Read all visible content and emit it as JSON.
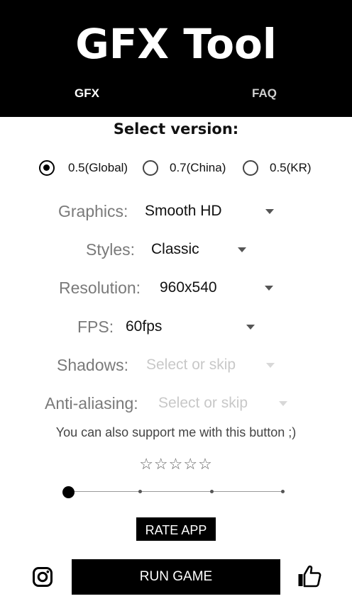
{
  "header": {
    "title": "GFX Tool",
    "tabs": [
      {
        "label": "GFX",
        "active": true
      },
      {
        "label": "FAQ",
        "active": false
      }
    ]
  },
  "version": {
    "title": "Select version:",
    "options": [
      {
        "label": "0.5(Global)",
        "selected": true
      },
      {
        "label": "0.7(China)",
        "selected": false
      },
      {
        "label": "0.5(KR)",
        "selected": false
      }
    ]
  },
  "settings": {
    "graphics": {
      "label": "Graphics:",
      "value": "Smooth HD"
    },
    "styles": {
      "label": "Styles:",
      "value": "Classic"
    },
    "resolution": {
      "label": "Resolution:",
      "value": "960x540"
    },
    "fps": {
      "label": "FPS:",
      "value": "60fps"
    },
    "shadows": {
      "label": "Shadows:",
      "placeholder": "Select or skip"
    },
    "anti_aliasing": {
      "label": "Anti-aliasing:",
      "placeholder": "Select or skip"
    }
  },
  "support": {
    "text": "You can also support me with this button ;)",
    "stars": "☆☆☆☆☆",
    "rating": 0,
    "slider_position": 0
  },
  "actions": {
    "rate_label": "RATE APP",
    "run_label": "RUN GAME"
  },
  "icons": {
    "left": "instagram-icon",
    "right": "thumbs-up-icon"
  },
  "colors": {
    "header_bg": "#000000",
    "accent": "#000000",
    "muted_label": "#7a7a7a",
    "placeholder": "#c8c8c8"
  }
}
